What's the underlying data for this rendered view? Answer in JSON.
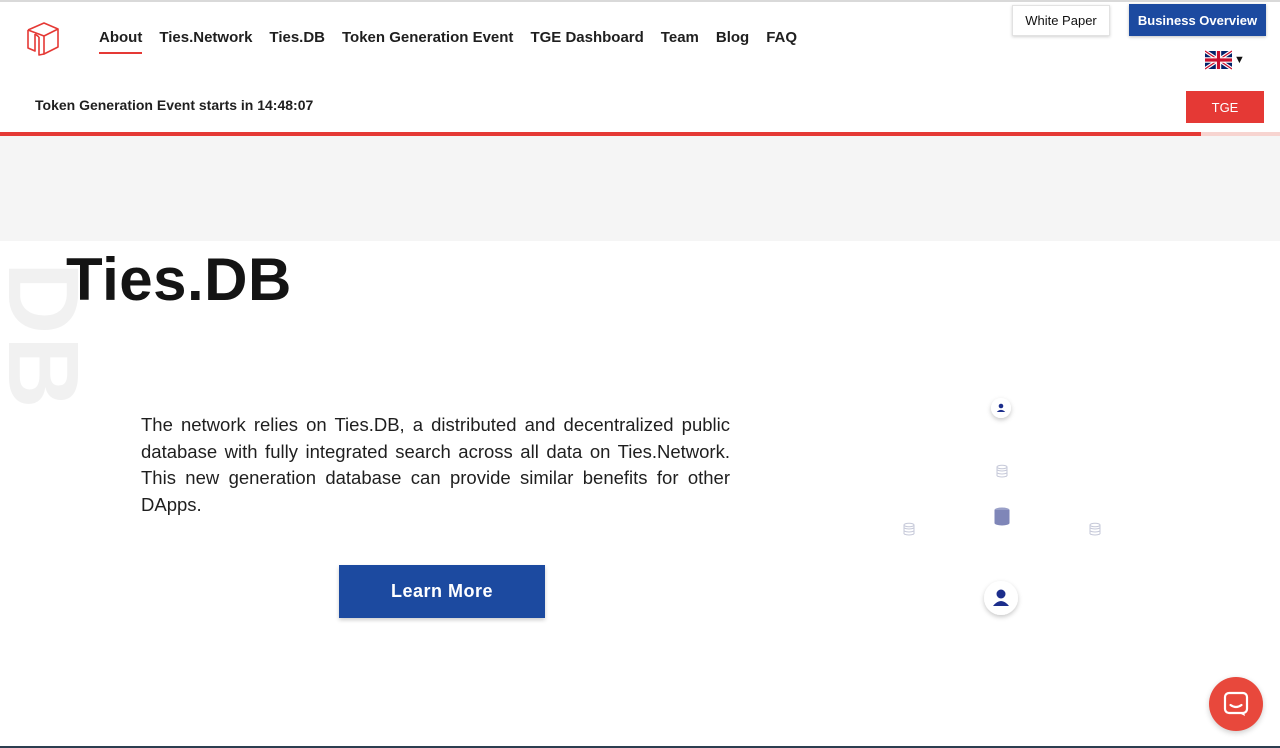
{
  "nav": {
    "items": [
      {
        "label": "About",
        "active": true
      },
      {
        "label": "Ties.Network",
        "active": false
      },
      {
        "label": "Ties.DB",
        "active": false
      },
      {
        "label": "Token Generation Event",
        "active": false
      },
      {
        "label": "TGE Dashboard",
        "active": false
      },
      {
        "label": "Team",
        "active": false
      },
      {
        "label": "Blog",
        "active": false
      },
      {
        "label": "FAQ",
        "active": false
      }
    ]
  },
  "header": {
    "white_paper_label": "White Paper",
    "business_overview_label": "Business Overview",
    "language_icon": "uk-flag-icon"
  },
  "countdown": {
    "text": "Token Generation Event starts in 14:48:07",
    "tge_label": "TGE",
    "progress": 0.938
  },
  "hero": {
    "watermark": "DB",
    "title": "Ties.DB",
    "description": "The network relies on Ties.DB, a distributed and decentralized public database with fully integrated search across all data on Ties.Network. This new generation database can provide similar benefits for other DApps.",
    "learn_more_label": "Learn More"
  },
  "colors": {
    "accent_red": "#e53935",
    "brand_blue": "#1c4aa0",
    "chat_red": "#e8483c"
  },
  "icons": {
    "logo": "ties-network-logo",
    "chat": "chat-icon",
    "user": "user-icon",
    "database": "database-icon"
  }
}
